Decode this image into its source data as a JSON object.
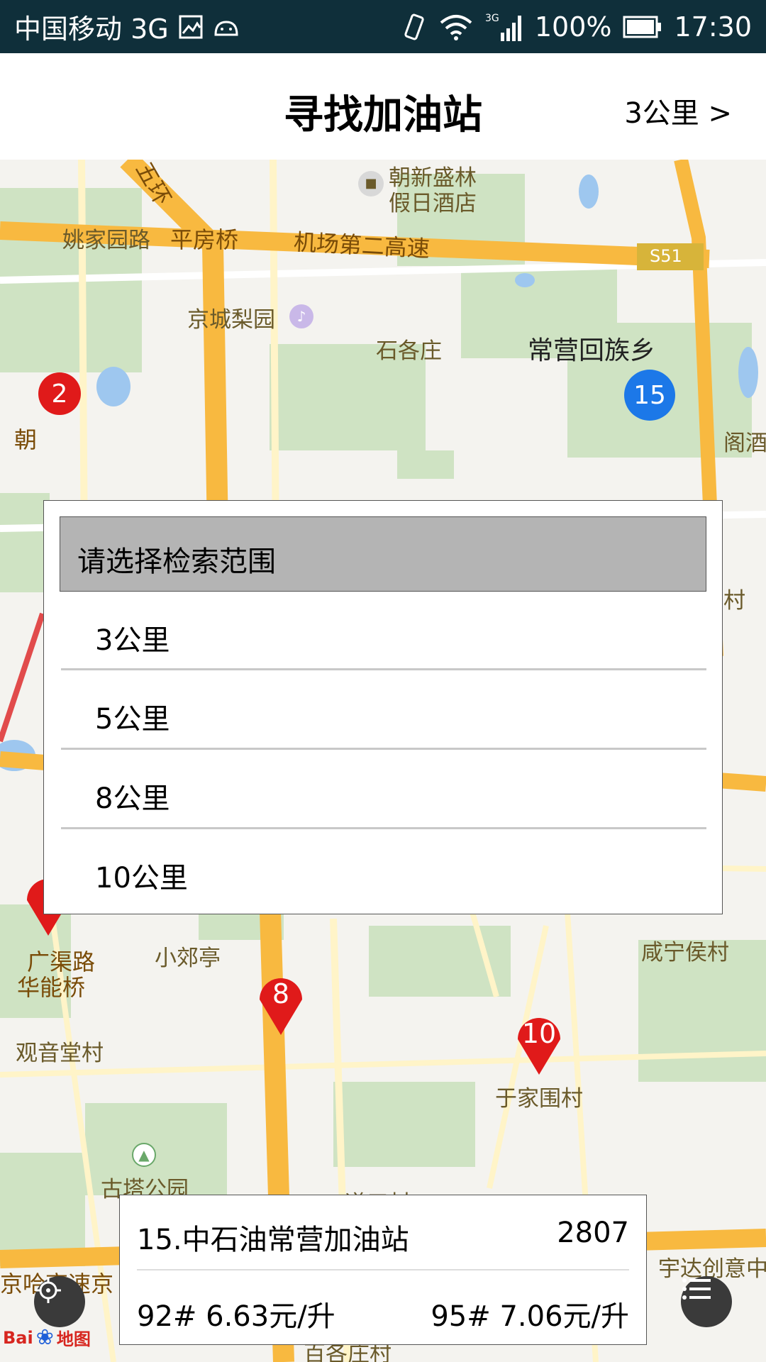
{
  "status_bar": {
    "carrier": "中国移动 3G",
    "network_label": "3G",
    "battery": "100%",
    "time": "17:30"
  },
  "header": {
    "title": "寻找加油站",
    "range_link": "3公里 >"
  },
  "map": {
    "labels": {
      "hotel_line1": "朝新盛林",
      "hotel_line2": "假日酒店",
      "yaojiayuan_road": "姚家园路",
      "pingfang_bridge": "平房桥",
      "airport_expressway": "机场第二高速",
      "s51": "S51",
      "jingcheng_liyuan": "京城梨园",
      "shigezhuang": "石各庄",
      "changying_township": "常营回族乡",
      "wuhuan": "五环",
      "chao_partial": "朝",
      "ge_jiudian_partial": "阁酒店",
      "cun_partial": "村",
      "xiaojiaoting": "小郊亭",
      "xianning_houcun": "咸宁侯村",
      "guangqu_road": "广渠路",
      "huaneng_bridge": "华能桥",
      "guanyintang_village": "观音堂村",
      "yujiawei_village": "于家围村",
      "guta_park": "古塔公园",
      "daohui_partial": "道口村",
      "yuda_partial": "宇达创意中",
      "jinghaa_partial": "京哈高速京",
      "baige_partial": "百各庄村"
    },
    "markers": {
      "m2": "2",
      "m15": "15",
      "m8": "8",
      "m10": "10"
    },
    "logo_text": "Bai",
    "logo_map": "地图"
  },
  "dialog": {
    "title": "请选择检索范围",
    "options": [
      "3公里",
      "5公里",
      "8公里",
      "10公里"
    ]
  },
  "station_card": {
    "name": "15.中石油常营加油站",
    "distance": "2807",
    "price_92": "92# 6.63元/升",
    "price_95": "95# 7.06元/升"
  },
  "colors": {
    "status_bar": "#0f2f3a",
    "road_major": "#f8b940",
    "marker_red": "#e01a1a",
    "marker_blue": "#1c78e8",
    "dialog_header": "#b4b4b4"
  }
}
